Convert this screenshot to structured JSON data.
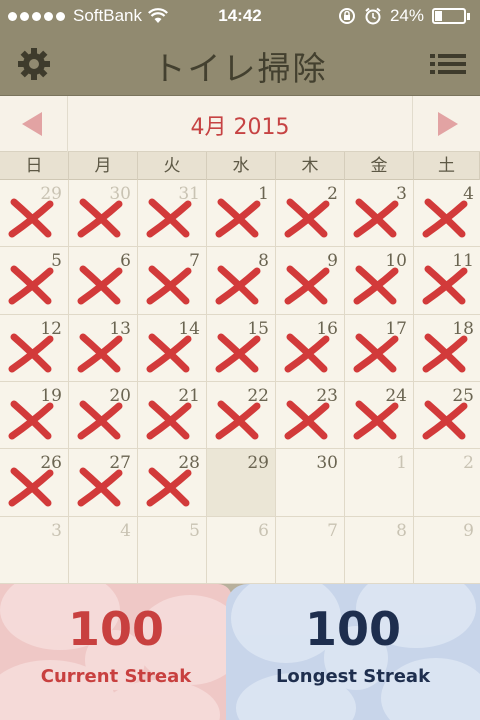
{
  "status": {
    "carrier": "SoftBank",
    "time": "14:42",
    "battery": "24%",
    "battery_level": 0.24
  },
  "nav": {
    "title": "トイレ掃除",
    "left_icon": "gear-icon",
    "right_icon": "menu-icon"
  },
  "calendar": {
    "month_label": "4月 2015",
    "prev_icon": "triangle-left-icon",
    "next_icon": "triangle-right-icon",
    "weekdays": [
      "日",
      "月",
      "火",
      "水",
      "木",
      "金",
      "土"
    ],
    "days": [
      {
        "n": "29",
        "other": true,
        "marked": true
      },
      {
        "n": "30",
        "other": true,
        "marked": true
      },
      {
        "n": "31",
        "other": true,
        "marked": true
      },
      {
        "n": "1",
        "other": false,
        "marked": true
      },
      {
        "n": "2",
        "other": false,
        "marked": true
      },
      {
        "n": "3",
        "other": false,
        "marked": true
      },
      {
        "n": "4",
        "other": false,
        "marked": true
      },
      {
        "n": "5",
        "other": false,
        "marked": true
      },
      {
        "n": "6",
        "other": false,
        "marked": true
      },
      {
        "n": "7",
        "other": false,
        "marked": true
      },
      {
        "n": "8",
        "other": false,
        "marked": true
      },
      {
        "n": "9",
        "other": false,
        "marked": true
      },
      {
        "n": "10",
        "other": false,
        "marked": true
      },
      {
        "n": "11",
        "other": false,
        "marked": true
      },
      {
        "n": "12",
        "other": false,
        "marked": true
      },
      {
        "n": "13",
        "other": false,
        "marked": true
      },
      {
        "n": "14",
        "other": false,
        "marked": true
      },
      {
        "n": "15",
        "other": false,
        "marked": true
      },
      {
        "n": "16",
        "other": false,
        "marked": true
      },
      {
        "n": "17",
        "other": false,
        "marked": true
      },
      {
        "n": "18",
        "other": false,
        "marked": true
      },
      {
        "n": "19",
        "other": false,
        "marked": true
      },
      {
        "n": "20",
        "other": false,
        "marked": true
      },
      {
        "n": "21",
        "other": false,
        "marked": true
      },
      {
        "n": "22",
        "other": false,
        "marked": true
      },
      {
        "n": "23",
        "other": false,
        "marked": true
      },
      {
        "n": "24",
        "other": false,
        "marked": true
      },
      {
        "n": "25",
        "other": false,
        "marked": true
      },
      {
        "n": "26",
        "other": false,
        "marked": true
      },
      {
        "n": "27",
        "other": false,
        "marked": true
      },
      {
        "n": "28",
        "other": false,
        "marked": true
      },
      {
        "n": "29",
        "other": false,
        "marked": false,
        "today": true
      },
      {
        "n": "30",
        "other": false,
        "marked": false
      },
      {
        "n": "1",
        "other": true,
        "marked": false
      },
      {
        "n": "2",
        "other": true,
        "marked": false
      },
      {
        "n": "3",
        "other": true,
        "marked": false
      },
      {
        "n": "4",
        "other": true,
        "marked": false
      },
      {
        "n": "5",
        "other": true,
        "marked": false
      },
      {
        "n": "6",
        "other": true,
        "marked": false
      },
      {
        "n": "7",
        "other": true,
        "marked": false
      },
      {
        "n": "8",
        "other": true,
        "marked": false
      },
      {
        "n": "9",
        "other": true,
        "marked": false
      }
    ]
  },
  "streaks": {
    "current_value": "100",
    "current_label": "Current Streak",
    "longest_value": "100",
    "longest_label": "Longest Streak"
  },
  "colors": {
    "accent_red": "#c64343",
    "mark_red": "#d23a3a",
    "current_text": "#c8403f",
    "longest_text": "#1e2e4e",
    "nav_bg": "#918a70"
  }
}
